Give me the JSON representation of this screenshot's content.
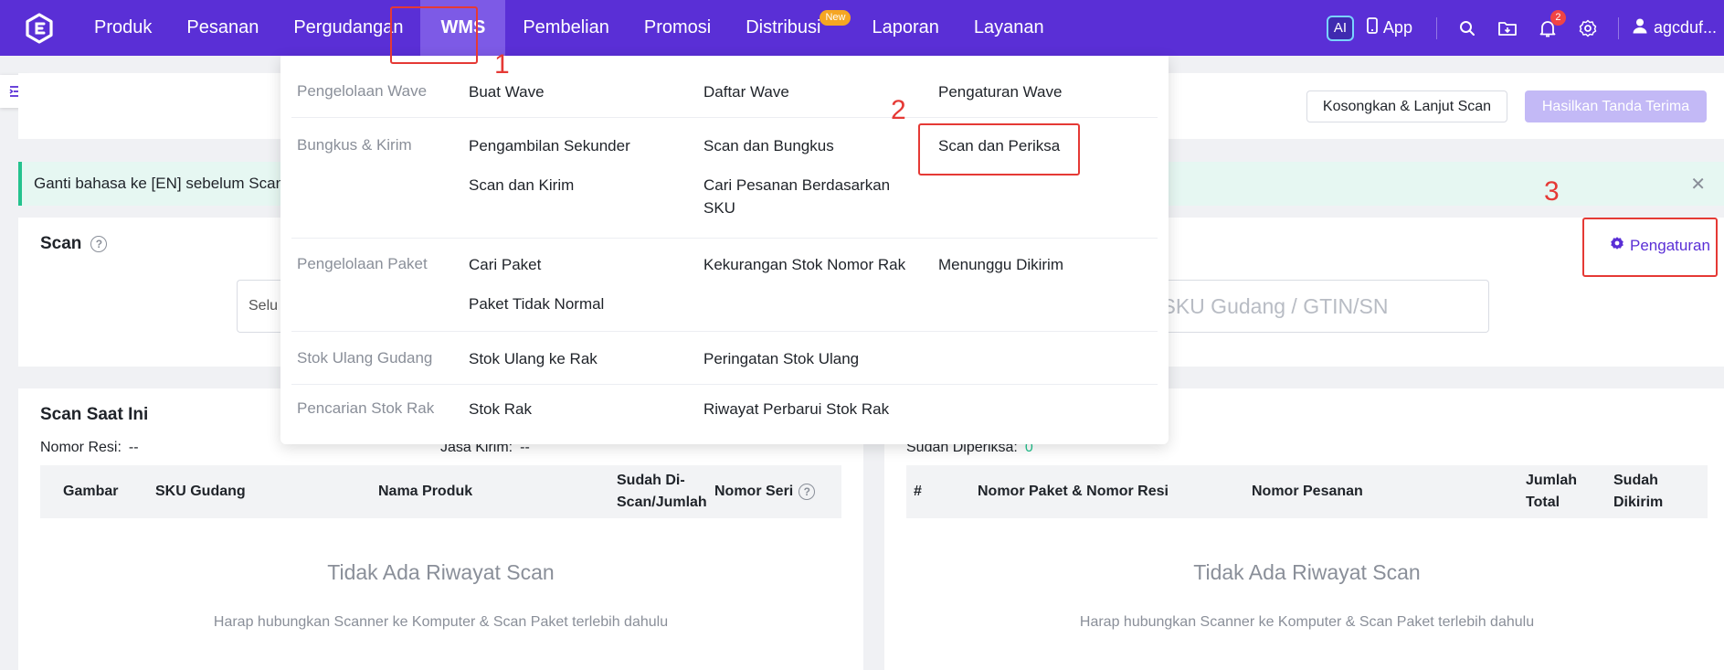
{
  "nav": {
    "items": [
      {
        "label": "Produk"
      },
      {
        "label": "Pesanan"
      },
      {
        "label": "Pergudangan"
      },
      {
        "label": "WMS"
      },
      {
        "label": "Pembelian"
      },
      {
        "label": "Promosi"
      },
      {
        "label": "Distribusi",
        "badge": "New"
      },
      {
        "label": "Laporan"
      },
      {
        "label": "Layanan"
      }
    ],
    "ai_label": "AI",
    "app_label": "App",
    "notification_count": "2",
    "user_name": "agcduf..."
  },
  "dropdown": {
    "rows": [
      {
        "category": "Pengelolaan Wave",
        "items": [
          "Buat Wave",
          "Daftar Wave",
          "Pengaturan Wave"
        ]
      },
      {
        "category": "Bungkus & Kirim",
        "items": [
          "Pengambilan Sekunder",
          "Scan dan Bungkus",
          "Scan dan Periksa",
          "Scan dan Kirim",
          "Cari Pesanan Berdasarkan SKU"
        ]
      },
      {
        "category": "Pengelolaan Paket",
        "items": [
          "Cari Paket",
          "Kekurangan Stok Nomor Rak",
          "Menunggu Dikirim",
          "Paket Tidak Normal"
        ]
      },
      {
        "category": "Stok Ulang Gudang",
        "items": [
          "Stok Ulang ke Rak",
          "Peringatan Stok Ulang"
        ]
      },
      {
        "category": "Pencarian Stok Rak",
        "items": [
          "Stok Rak",
          "Riwayat Perbarui Stok Rak"
        ]
      }
    ]
  },
  "toolbar": {
    "clear_button": "Kosongkan & Lanjut Scan",
    "generate_button": "Hasilkan Tanda Terima"
  },
  "alert": {
    "message": "Ganti bahasa ke [EN] sebelum Scan."
  },
  "scan": {
    "title": "Scan",
    "select_value": "Selu",
    "input_placeholder": "i SKU Gudang / GTIN/SN",
    "settings_label": "Pengaturan"
  },
  "current_scan": {
    "title": "Scan Saat Ini",
    "tracking_label": "Nomor Resi:",
    "tracking_value": "--",
    "courier_label": "Jasa Kirim:",
    "courier_value": "--",
    "columns": [
      "Gambar",
      "SKU Gudang",
      "Nama Produk",
      "Sudah Di-Scan/Jumlah",
      "Nomor Seri"
    ],
    "empty_title": "Tidak Ada Riwayat Scan",
    "empty_sub": "Harap hubungkan Scanner ke Komputer & Scan Paket terlebih dahulu"
  },
  "checked": {
    "checked_label": "Sudah Diperiksa:",
    "checked_value": "0",
    "columns": [
      "#",
      "Nomor Paket & Nomor Resi",
      "Nomor Pesanan",
      "Jumlah Total",
      "Sudah Dikirim"
    ],
    "empty_title": "Tidak Ada Riwayat Scan",
    "empty_sub": "Harap hubungkan Scanner ke Komputer & Scan Paket terlebih dahulu"
  },
  "annotations": {
    "step1": "1",
    "step2": "2",
    "step3": "3"
  },
  "colors": {
    "brand": "#5a2fd6",
    "highlight": "#e53935",
    "success": "#24c28e"
  },
  "icons": [
    "logo-icon",
    "ai-icon",
    "phone-icon",
    "search-icon",
    "folder-download-icon",
    "bell-icon",
    "gear-icon",
    "user-icon",
    "sidebar-toggle-icon",
    "help-icon",
    "close-icon"
  ]
}
